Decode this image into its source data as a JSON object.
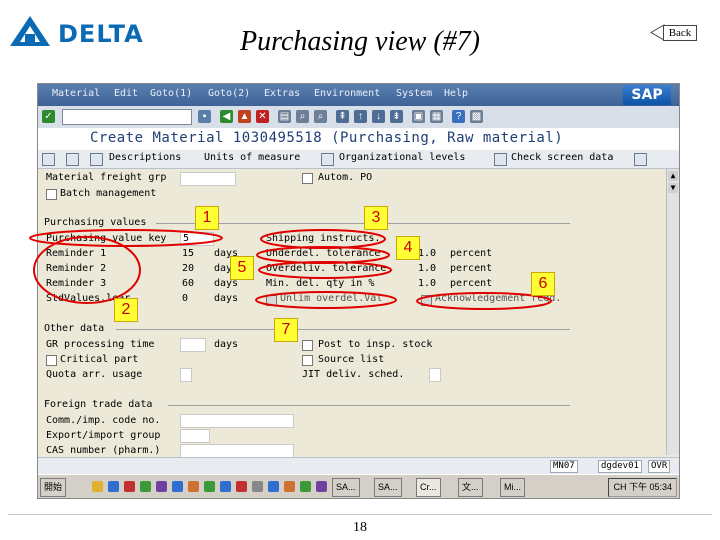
{
  "slide": {
    "logo_text": "DELTA",
    "title": "Purchasing view (#7)",
    "back_label": "Back",
    "page_number": "18"
  },
  "sap": {
    "menu": [
      "Material",
      "Edit",
      "Goto(1)",
      "Goto(2)",
      "Extras",
      "Environment",
      "System",
      "Help"
    ],
    "logo": "SAP",
    "screen_title": "Create Material 1030495518 (Purchasing, Raw material)",
    "app_toolbar": {
      "descriptions": "Descriptions",
      "units": "Units of measure",
      "org_levels": "Organizational levels",
      "check_screen": "Check screen data"
    },
    "top_section": {
      "freight_group": "Material freight grp",
      "autom_po": "Autom. PO",
      "batch_mgmt": "Batch management"
    },
    "purchasing_values": {
      "group_title": "Purchasing values",
      "value_key_label": "Purchasing value key",
      "value_key": "5",
      "reminders": [
        {
          "label": "Reminder 1",
          "value": "15",
          "unit": "days"
        },
        {
          "label": "Reminder 2",
          "value": "20",
          "unit": "days"
        },
        {
          "label": "Reminder 3",
          "value": "60",
          "unit": "days"
        }
      ],
      "std_values_label": "StdValues.lear.",
      "std_values_value": "0",
      "std_values_unit": "days",
      "shipping_instr": "Shipping instructs.",
      "underdel_tol": "Underdel. tolerance",
      "underdel_value": "1.0",
      "overdel_tol": "Overdeliv. tolerance",
      "overdel_value": "1.0",
      "min_del_qty": "Min. del. qty in %",
      "min_del_value": "1.0",
      "percent": "percent",
      "unlimited_overdel": "Unlim overdel.Val",
      "acknowledgement": "Acknowledgement reqd."
    },
    "other_data": {
      "group_title": "Other data",
      "gr_processing": "GR processing time",
      "gr_unit": "days",
      "critical_part": "Critical part",
      "quota_usage": "Quota arr. usage",
      "post_to_insp": "Post to insp. stock",
      "source_list": "Source list",
      "jit_sched": "JIT deliv. sched."
    },
    "foreign_trade": {
      "group_title": "Foreign trade data",
      "comm_code": "Comm./imp. code no.",
      "export_group": "Export/import group",
      "cas_number": "CAS number (pharm.)"
    },
    "status": {
      "client": "MN07",
      "server": "dgdev01",
      "mode": "OVR"
    },
    "taskbar": {
      "start": "開始",
      "tasks": [
        "SA...",
        "SA...",
        "Cr...",
        "文...",
        "Mi..."
      ],
      "tray": "CH",
      "clock": "下午 05:34"
    }
  },
  "annotations": [
    "1",
    "2",
    "3",
    "4",
    "5",
    "6",
    "7"
  ],
  "colors": {
    "sap_blue": "#3d6296",
    "sap_bg": "#ece9d8",
    "highlight_red": "#e00000",
    "badge_yellow": "#ffff33",
    "logo_blue": "#0a6bb4"
  }
}
